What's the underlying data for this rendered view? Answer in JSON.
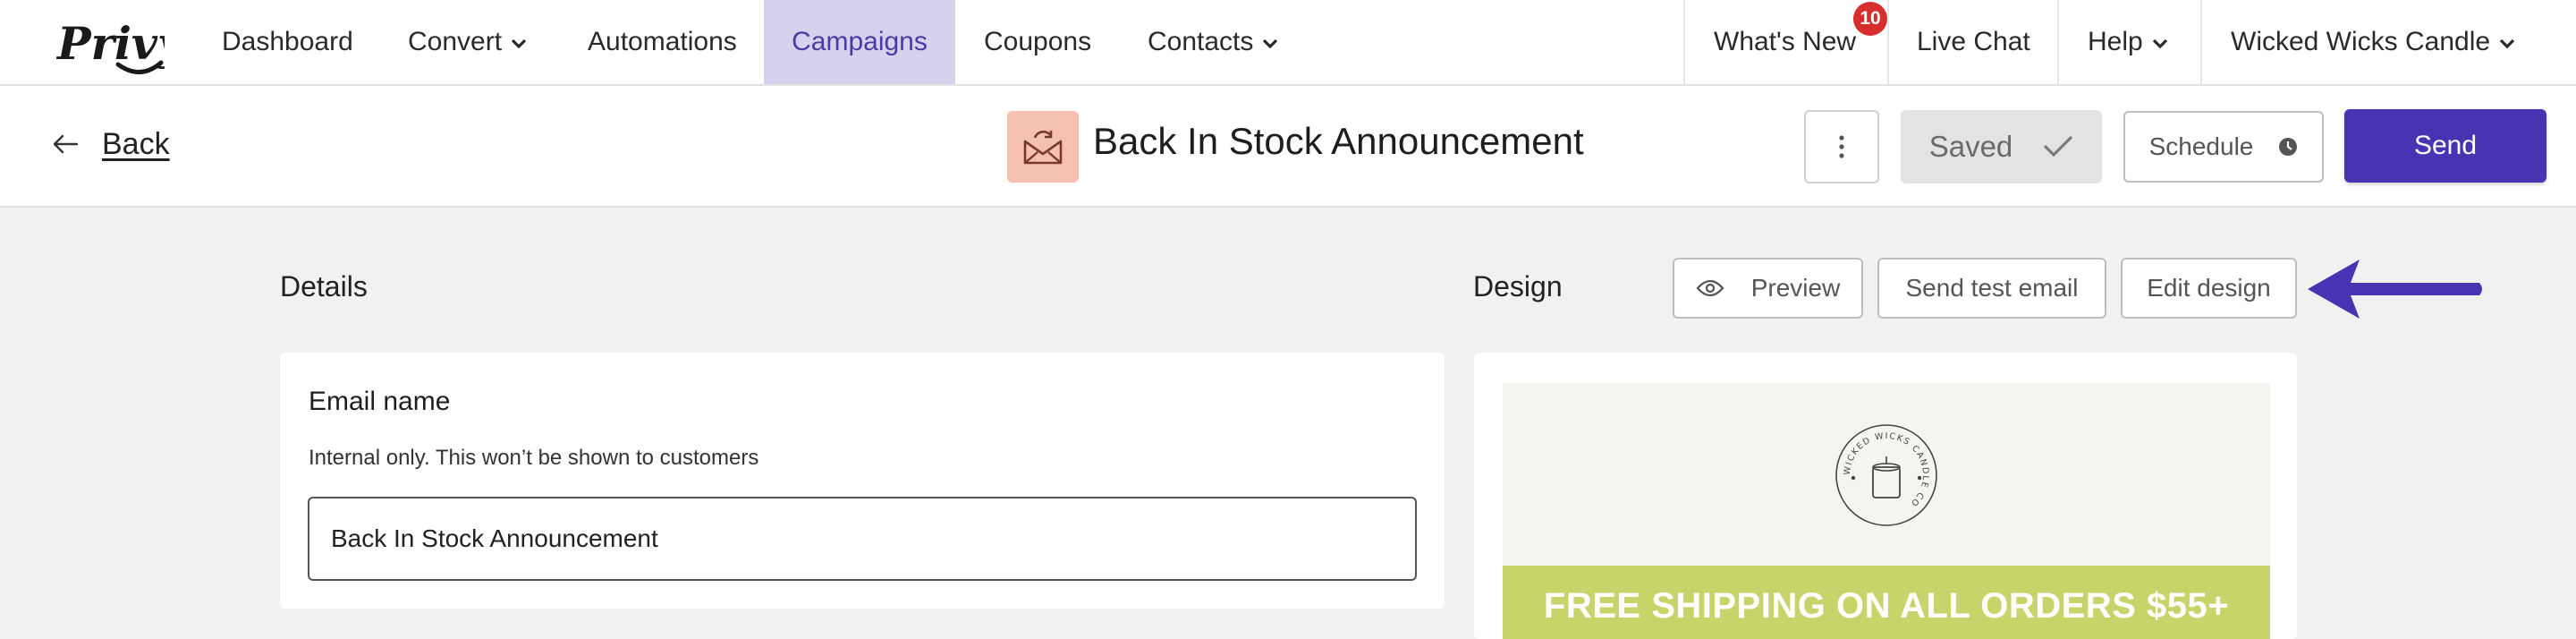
{
  "nav": {
    "logo_text": "Privy",
    "items": [
      {
        "label": "Dashboard"
      },
      {
        "label": "Convert"
      },
      {
        "label": "Automations"
      },
      {
        "label": "Campaigns"
      },
      {
        "label": "Coupons"
      },
      {
        "label": "Contacts"
      }
    ],
    "active_item": "Campaigns",
    "right": {
      "whats_new": "What's New",
      "whats_new_badge": "10",
      "live_chat": "Live Chat",
      "help": "Help",
      "account": "Wicked Wicks Candle"
    }
  },
  "header": {
    "back_label": "Back",
    "campaign_title": "Back In Stock Announcement",
    "saved_label": "Saved",
    "schedule_label": "Schedule",
    "send_label": "Send"
  },
  "details": {
    "section_title": "Details",
    "card_heading": "Email name",
    "help_text": "Internal only. This won’t be shown to customers",
    "email_name_value": "Back In Stock Announcement"
  },
  "design": {
    "section_title": "Design",
    "preview_label": "Preview",
    "send_test_label": "Send test email",
    "edit_design_label": "Edit design",
    "preview": {
      "brand_seal_text": "WICKED WICKS CANDLE CO",
      "banner_text": "FREE SHIPPING ON ALL ORDERS $55+"
    }
  },
  "colors": {
    "accent": "#4a33b3",
    "active_nav_bg": "#d8d1ee",
    "badge": "#d62d2d",
    "campaign_icon_bg": "#f4c1b0",
    "banner": "#c8d36a",
    "pointer_arrow": "#4a33b3"
  },
  "icons": {
    "back": "arrow-left-icon",
    "campaign": "email-refresh-icon",
    "more": "vertical-dots-icon",
    "saved": "checkmark-icon",
    "schedule": "clock-icon",
    "preview": "eye-icon",
    "dropdown": "chevron-down-icon"
  }
}
